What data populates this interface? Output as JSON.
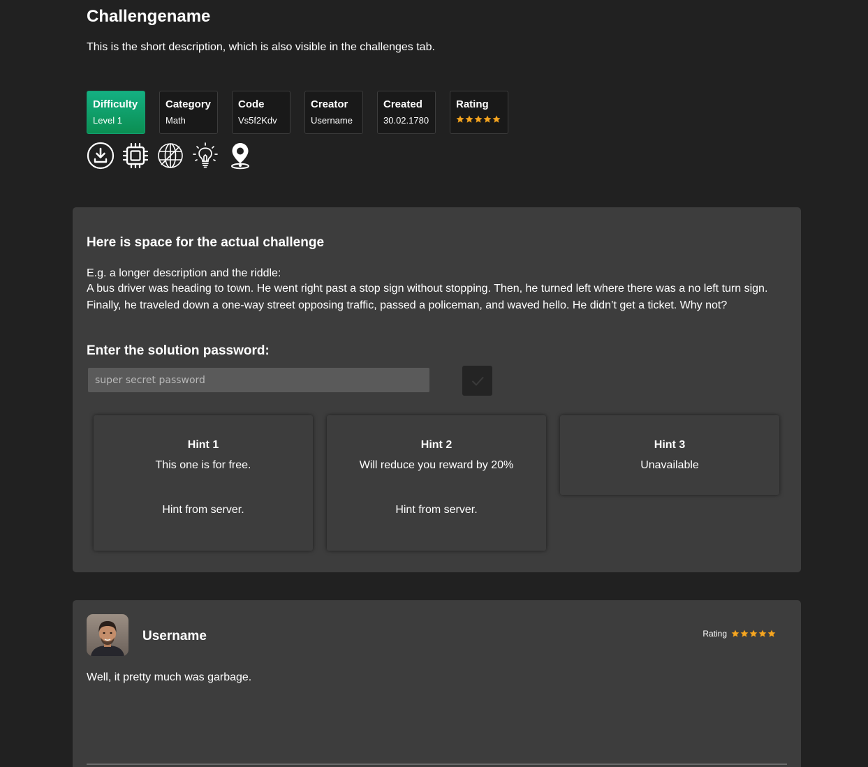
{
  "challenge": {
    "title": "Challengename",
    "short_description": "This is the short description, which is also visible in the challenges tab."
  },
  "info_cards": [
    {
      "label": "Difficulty",
      "value": "Level 1"
    },
    {
      "label": "Category",
      "value": "Math"
    },
    {
      "label": "Code",
      "value": "Vs5f2Kdv"
    },
    {
      "label": "Creator",
      "value": "Username"
    },
    {
      "label": "Created",
      "value": "30.02.1780"
    },
    {
      "label": "Rating",
      "stars": 5,
      "max_stars": 5
    }
  ],
  "icons": [
    "download-icon",
    "cpu-chip-icon",
    "globe-icon",
    "lightbulb-icon",
    "map-pin-icon"
  ],
  "main": {
    "heading": "Here is space for the actual challenge",
    "intro": "E.g. a longer description and the riddle:",
    "riddle": "A bus driver was heading to town. He went right past a stop sign without stopping. Then, he turned left where there was a no left turn sign. Finally, he traveled down a one-way street opposing traffic, passed a policeman, and waved hello. He didn’t get a ticket. Why not?",
    "solution_label": "Enter the solution password:",
    "password_placeholder": "super secret password",
    "submit_icon": "checkmark-icon"
  },
  "hints": [
    {
      "title": "Hint 1",
      "description": "This one is for free.",
      "content": "Hint from server."
    },
    {
      "title": "Hint 2",
      "description": "Will reduce you reward by 20%",
      "content": "Hint from server."
    },
    {
      "title": "Hint 3",
      "description": "Unavailable"
    }
  ],
  "comment": {
    "username": "Username",
    "rating_label": "Rating",
    "stars": 5,
    "max_stars": 5,
    "text": "Well, it pretty much was garbage."
  },
  "colors": {
    "background": "#212121",
    "panel": "#3d3d3d",
    "difficulty_accent": "#11a270",
    "star": "#f5a623"
  }
}
